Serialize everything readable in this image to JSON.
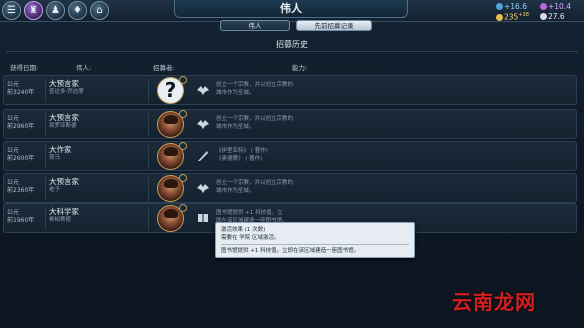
{
  "window": {
    "title": "伟人"
  },
  "top_icons": [
    "book-icon",
    "palace-icon",
    "people-icon",
    "crest-icon",
    "building-icon"
  ],
  "stats": {
    "science": "+16.6",
    "culture": "+10.4",
    "gold": "235",
    "gold_rate": "+38",
    "faith": "27.6"
  },
  "tabs": [
    {
      "label": "伟人"
    },
    {
      "label": "先前招募记录"
    }
  ],
  "section_title": "招募历史",
  "columns": {
    "date": "获得日期:",
    "person": "伟人:",
    "recruiter": "招募者:",
    "ability": "能力:"
  },
  "rows": [
    {
      "date_era": "公元",
      "date_year": "前3240年",
      "name": "大预言家",
      "person": "查达多·乔达摩",
      "portrait": "question-mark",
      "desc": [
        "创立一个宗教，并以创立宗教的",
        "城市作为圣城。"
      ]
    },
    {
      "date_era": "公元",
      "date_year": "前2960年",
      "name": "大预言家",
      "person": "琐罗亚斯德",
      "portrait": "face",
      "desc": [
        "创立一个宗教，并以创立宗教的",
        "城市作为圣城。"
      ]
    },
    {
      "date_era": "公元",
      "date_year": "前2600年",
      "name": "大作家",
      "person": "荷马",
      "portrait": "face",
      "desc": [
        "《伊里亚特》 (  著作)",
        "《奥德赛》 (  著作)"
      ]
    },
    {
      "date_era": "公元",
      "date_year": "前2360年",
      "name": "大预言家",
      "person": "老子",
      "portrait": "face",
      "desc": [
        "创立一个宗教，并以创立宗教的",
        "城市作为圣城。"
      ]
    },
    {
      "date_era": "公元",
      "date_year": "前1960年",
      "name": "大科学家",
      "person": "希帕蒂娅",
      "portrait": "face",
      "desc": [
        "图书馆提供 +1  科技值。立",
        "即在该区域建造一座图书馆。"
      ]
    }
  ],
  "tooltip": {
    "line1": "激活效果 (1 次数)",
    "line2": "需要在 学院 区域激活。",
    "line3": "图书馆提供 +1  科技值。立即在该区域建造一座图书馆。"
  },
  "watermark": "云南龙网",
  "colors": {
    "accent": "#c4a15a",
    "science": "#4fa3d9",
    "culture": "#b867e0",
    "gold": "#e8c14d",
    "faith": "#d9d9f0",
    "watermark": "#d51e1e"
  }
}
